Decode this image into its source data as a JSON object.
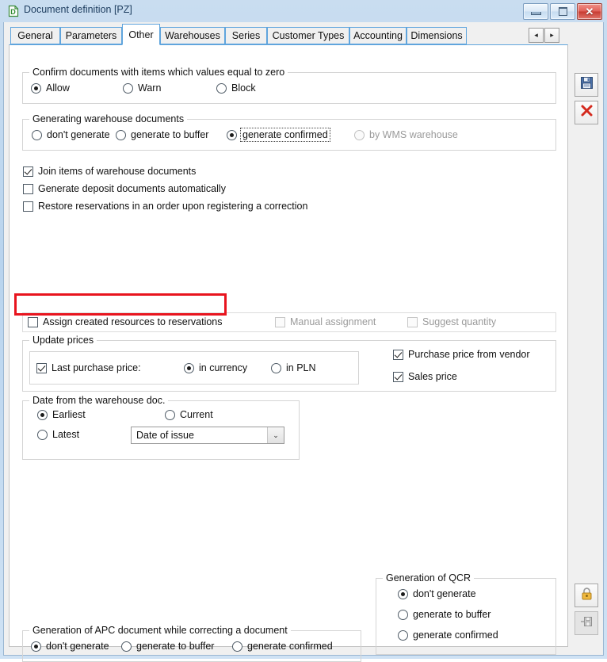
{
  "window": {
    "title": "Document definition [PZ]",
    "app_icon": "document-icon",
    "buttons": {
      "minimize": "minimize-icon",
      "maximize": "maximize-icon",
      "close": "close-icon"
    }
  },
  "tabs": [
    {
      "label": "General",
      "active": false
    },
    {
      "label": "Parameters",
      "active": false
    },
    {
      "label": "Other",
      "active": true
    },
    {
      "label": "Warehouses",
      "active": false
    },
    {
      "label": "Series",
      "active": false
    },
    {
      "label": "Customer Types",
      "active": false
    },
    {
      "label": "Accounting",
      "active": false
    },
    {
      "label": "Dimensions",
      "active": false
    }
  ],
  "tab_nav": {
    "prev": "◂",
    "next": "▸"
  },
  "groups": {
    "confirm_zero": {
      "legend": "Confirm documents with items which values equal to zero",
      "options": [
        {
          "label": "Allow",
          "checked": true
        },
        {
          "label": "Warn",
          "checked": false
        },
        {
          "label": "Block",
          "checked": false
        }
      ]
    },
    "generating_wh": {
      "legend": "Generating warehouse documents",
      "options": [
        {
          "label": "don't generate",
          "checked": false,
          "disabled": false,
          "focused": false
        },
        {
          "label": "generate to buffer",
          "checked": false,
          "disabled": false,
          "focused": false
        },
        {
          "label": "generate confirmed",
          "checked": true,
          "disabled": false,
          "focused": true
        },
        {
          "label": "by WMS warehouse",
          "checked": false,
          "disabled": true,
          "focused": false
        }
      ]
    },
    "update_prices": {
      "legend": "Update prices",
      "last_purchase": {
        "label": "Last purchase price:",
        "checked": true
      },
      "currency_options": [
        {
          "label": "in currency",
          "checked": true
        },
        {
          "label": "in PLN",
          "checked": false
        }
      ],
      "side_checks": [
        {
          "label": "Purchase price from vendor",
          "checked": true
        },
        {
          "label": "Sales price",
          "checked": true
        }
      ]
    },
    "date_from_wh": {
      "legend": "Date from the warehouse doc.",
      "options": [
        {
          "label": "Earliest",
          "checked": true
        },
        {
          "label": "Current",
          "checked": false
        },
        {
          "label": "Latest",
          "checked": false
        }
      ],
      "combo_value": "Date of issue",
      "combo_arrow": "⌄"
    },
    "qcr": {
      "legend": "Generation of QCR",
      "options": [
        {
          "label": "don't generate",
          "checked": true
        },
        {
          "label": "generate to buffer",
          "checked": false
        },
        {
          "label": "generate confirmed",
          "checked": false
        }
      ]
    },
    "apc": {
      "legend": "Generation of APC document while correcting a document",
      "options": [
        {
          "label": "don't generate",
          "checked": true
        },
        {
          "label": "generate to buffer",
          "checked": false
        },
        {
          "label": "generate confirmed",
          "checked": false
        }
      ]
    }
  },
  "standalone_checks": [
    {
      "label": "Join items of warehouse documents",
      "checked": true,
      "disabled": false
    },
    {
      "label": "Generate deposit documents automatically",
      "checked": false,
      "disabled": false
    },
    {
      "label": "Restore reservations in an order upon registering a correction",
      "checked": false,
      "disabled": false
    }
  ],
  "assign_row": {
    "assign": {
      "label": "Assign created resources to reservations",
      "checked": false,
      "disabled": false,
      "highlighted": true
    },
    "manual": {
      "label": "Manual assignment",
      "checked": false,
      "disabled": true
    },
    "suggest": {
      "label": "Suggest quantity",
      "checked": false,
      "disabled": true
    }
  },
  "toolbar": {
    "save": {
      "icon": "save-floppy-icon",
      "enabled": true
    },
    "close": {
      "icon": "close-x-icon",
      "enabled": true
    },
    "lock": {
      "icon": "padlock-icon",
      "enabled": true
    },
    "pin_save": {
      "icon": "save-pin-icon",
      "enabled": false
    }
  },
  "colors": {
    "accent": "#60a5dd",
    "annotation": "#e8141e",
    "title_text": "#1c3c5e",
    "panel": "#f0f0f0",
    "page": "#ffffff",
    "disabled_text": "#9a9a9a"
  }
}
